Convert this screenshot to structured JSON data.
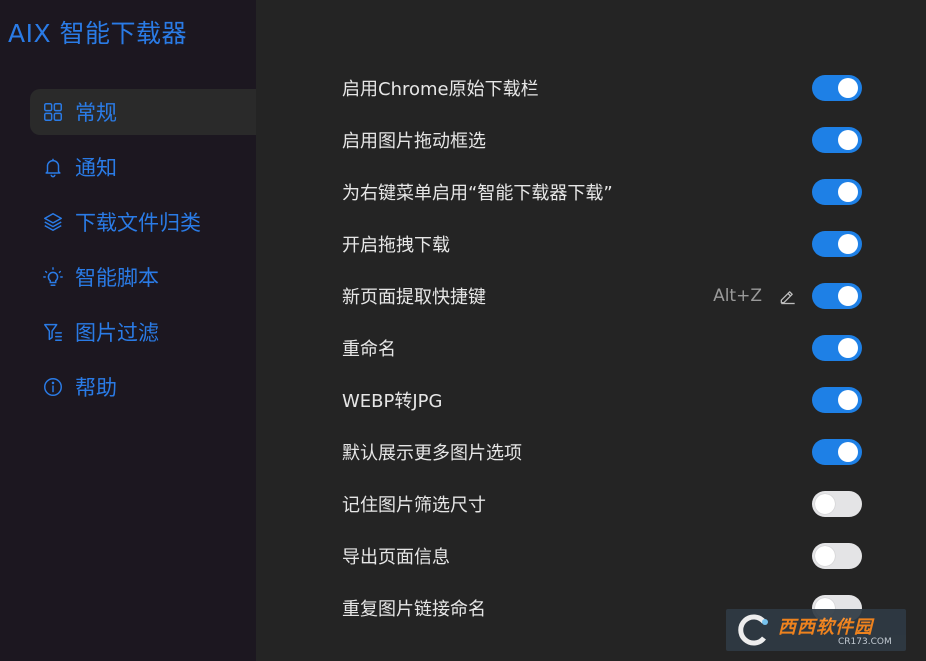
{
  "app": {
    "title": "AIX 智能下载器"
  },
  "sidebar": {
    "items": [
      {
        "label": "常规",
        "icon": "grid-icon",
        "active": true
      },
      {
        "label": "通知",
        "icon": "bell-icon",
        "active": false
      },
      {
        "label": "下载文件归类",
        "icon": "layers-icon",
        "active": false
      },
      {
        "label": "智能脚本",
        "icon": "lightbulb-icon",
        "active": false
      },
      {
        "label": "图片过滤",
        "icon": "filter-icon",
        "active": false
      },
      {
        "label": "帮助",
        "icon": "info-icon",
        "active": false
      }
    ]
  },
  "settings": {
    "rows": [
      {
        "label": "启用Chrome原始下载栏",
        "enabled": true
      },
      {
        "label": "启用图片拖动框选",
        "enabled": true
      },
      {
        "label": "为右键菜单启用“智能下载器下载”",
        "enabled": true
      },
      {
        "label": "开启拖拽下载",
        "enabled": true
      },
      {
        "label": "新页面提取快捷键",
        "enabled": true,
        "shortcut": "Alt+Z"
      },
      {
        "label": "重命名",
        "enabled": true
      },
      {
        "label": "WEBP转JPG",
        "enabled": true
      },
      {
        "label": "默认展示更多图片选项",
        "enabled": true
      },
      {
        "label": "记住图片筛选尺寸",
        "enabled": false
      },
      {
        "label": "导出页面信息",
        "enabled": false
      },
      {
        "label": "重复图片链接命名",
        "enabled": false
      }
    ]
  },
  "watermark": {
    "name": "西西软件园",
    "url": "CR173.COM"
  },
  "colors": {
    "accent": "#1e80e6",
    "sidebar_bg": "#1c1720",
    "main_bg": "#242424"
  }
}
